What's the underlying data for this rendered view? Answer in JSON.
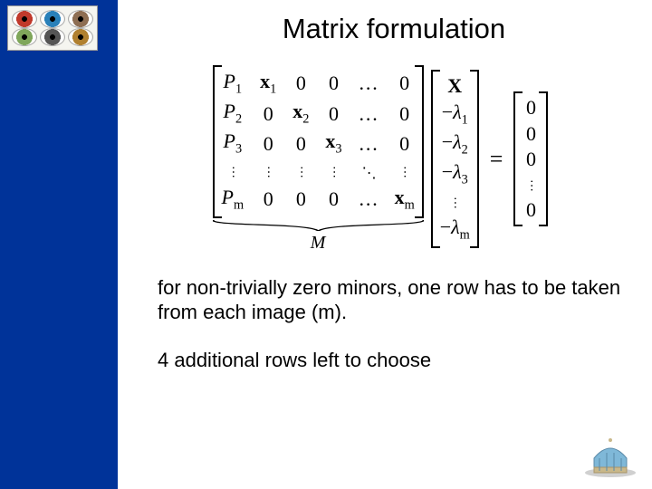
{
  "title": "Matrix formulation",
  "equation": {
    "M": {
      "rows": [
        [
          "P|1",
          "x|1",
          "0",
          "0",
          "…",
          "0"
        ],
        [
          "P|2",
          "0",
          "x|2",
          "0",
          "…",
          "0"
        ],
        [
          "P|3",
          "0",
          "0",
          "x|3",
          "…",
          "0"
        ],
        [
          "⋮",
          "⋮",
          "⋮",
          "⋮",
          "⋱",
          "⋮"
        ],
        [
          "P|m",
          "0",
          "0",
          "0",
          "…",
          "x|m"
        ]
      ],
      "underbrace_label": "M"
    },
    "vec": [
      "X",
      "−λ|1",
      "−λ|2",
      "−λ|3",
      "⋮",
      "−λ|m"
    ],
    "rhs": [
      "0",
      "0",
      "0",
      "⋮",
      "0"
    ],
    "equals": "="
  },
  "text1": "for non-trivially zero minors, one row has to be taken from each image (m).",
  "text2": "4 additional rows left to choose",
  "icons": {
    "logo_alt": "iris-eyes-logo",
    "corner_alt": "dome-building-icon"
  }
}
